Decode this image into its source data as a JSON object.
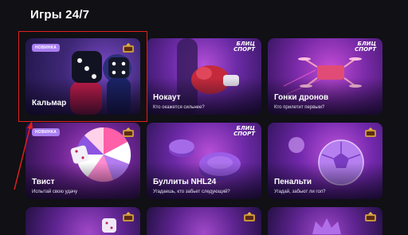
{
  "section": {
    "title": "Игры 24/7"
  },
  "cards": [
    {
      "title": "Кальмар",
      "subtitle": "",
      "badge": "НОВИНКА",
      "brand": ""
    },
    {
      "title": "Нокаут",
      "subtitle": "Кто окажется сильнее?",
      "badge": "",
      "brand": "БЛИЦ СПОРТ"
    },
    {
      "title": "Гонки дронов",
      "subtitle": "Кто прилетит первым?",
      "badge": "",
      "brand": "БЛИЦ СПОРТ"
    },
    {
      "title": "Твист",
      "subtitle": "Испытай свою удачу",
      "badge": "НОВИНКА",
      "brand": ""
    },
    {
      "title": "Буллиты NHL24",
      "subtitle": "Угадаешь, кто забьет следующий?",
      "badge": "",
      "brand": "БЛИЦ СПОРТ"
    },
    {
      "title": "Пенальти",
      "subtitle": "Угадай, забьют ли гол?",
      "badge": "",
      "brand": ""
    }
  ],
  "brand_lines": [
    "БЛИЦ",
    "СПОРТ"
  ],
  "colors": {
    "background": "#101015",
    "highlight": "#e0201f",
    "badge": "#a97ef0",
    "accent": "#8a2be2"
  }
}
